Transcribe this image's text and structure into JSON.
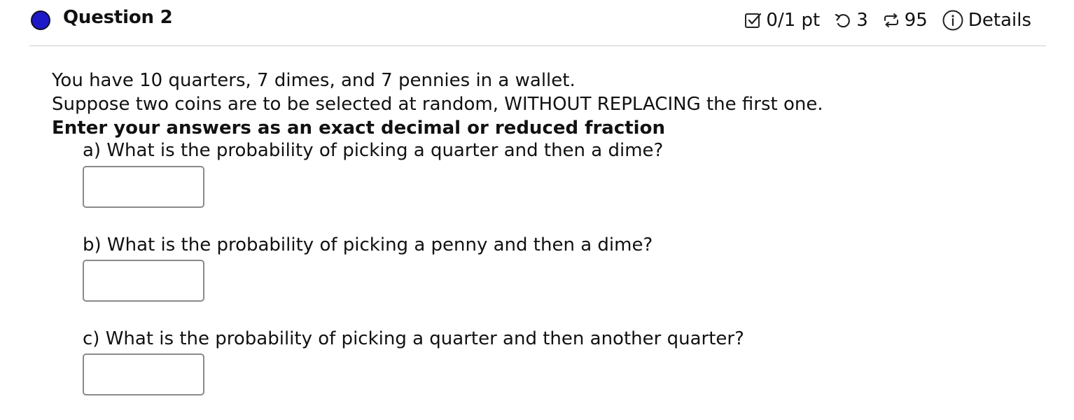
{
  "header": {
    "title": "Question 2",
    "score": "0/1 pt",
    "retries": "3",
    "submissions": "95",
    "details_label": "Details",
    "status_color": "#1d19c8",
    "icons": {
      "score": "checkbox-icon",
      "retries": "undo-icon",
      "submissions": "repeat-icon",
      "details": "info-icon"
    }
  },
  "question": {
    "line1": "You have 10 quarters, 7 dimes, and 7 pennies in a wallet.",
    "line2": "Suppose two coins are to be selected at random, WITHOUT REPLACING the first one.",
    "instruction": "Enter your answers as an exact decimal or reduced fraction",
    "parts": [
      {
        "label": "a) What is the probability of picking a quarter and then a dime?",
        "value": ""
      },
      {
        "label": "b) What is the probability of picking a penny and then a dime?",
        "value": ""
      },
      {
        "label": "c) What is the probability of picking a quarter and then another quarter?",
        "value": ""
      }
    ]
  }
}
